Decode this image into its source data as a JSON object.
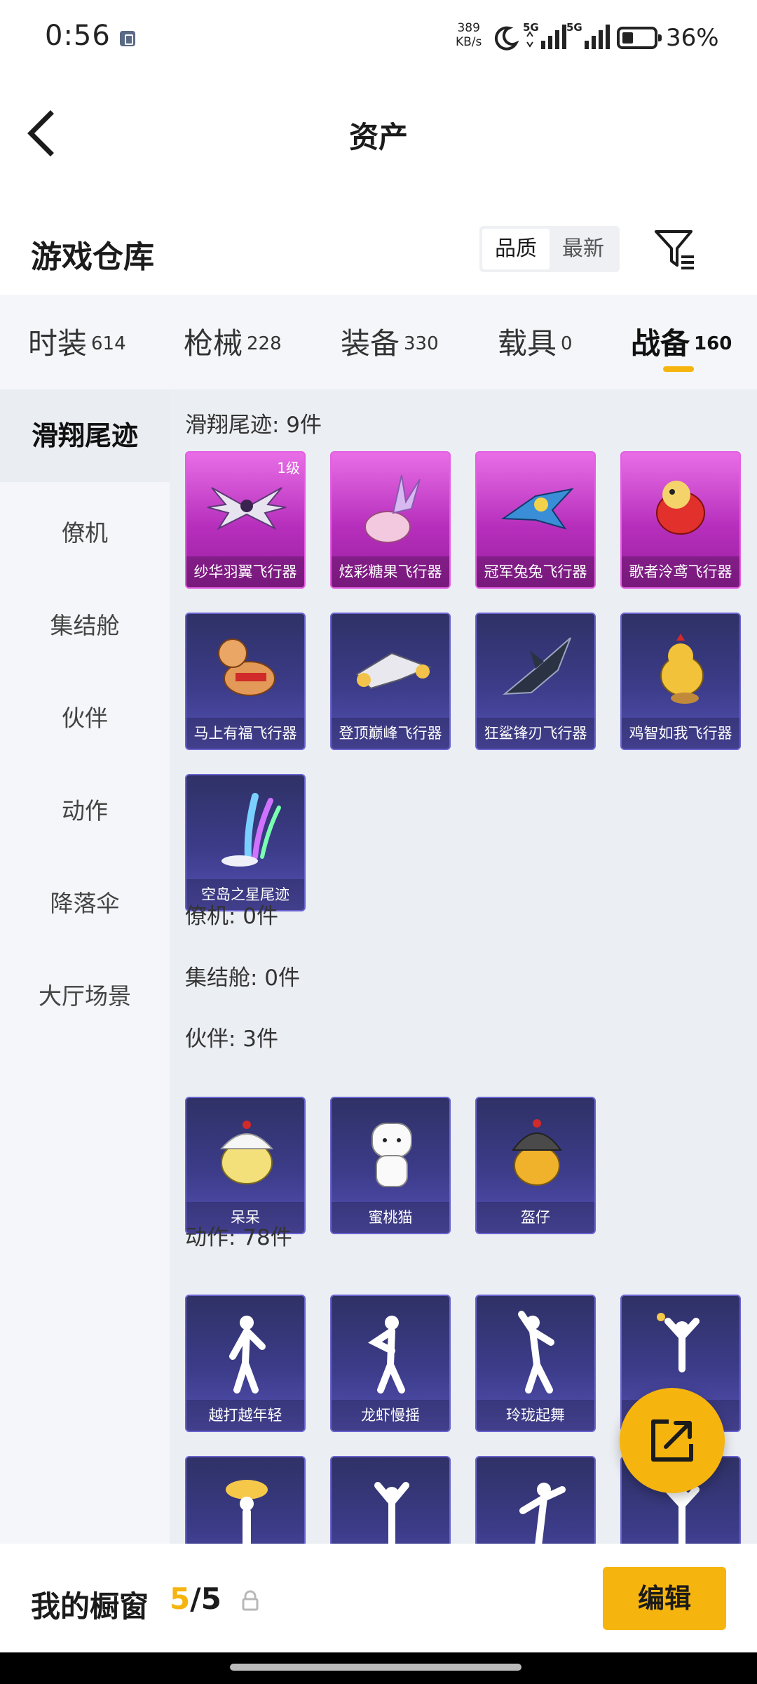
{
  "status_bar": {
    "time": "0:56",
    "net_speed_value": "389",
    "net_speed_unit": "KB/s",
    "signal1_label": "5G",
    "signal2_label": "5G",
    "battery_percent": "36%",
    "battery_level": 0.36
  },
  "header": {
    "title": "资产"
  },
  "warehouse": {
    "title": "游戏仓库",
    "sort_options": [
      "品质",
      "最新"
    ],
    "active_sort": "品质"
  },
  "categories": [
    {
      "name": "时装",
      "count": "614"
    },
    {
      "name": "枪械",
      "count": "228"
    },
    {
      "name": "装备",
      "count": "330"
    },
    {
      "name": "载具",
      "count": "0"
    },
    {
      "name": "战备",
      "count": "160"
    }
  ],
  "sidebar": {
    "items": [
      "滑翔尾迹",
      "僚机",
      "集结舱",
      "伙伴",
      "动作",
      "降落伞",
      "大厅场景"
    ]
  },
  "sections": {
    "glide": {
      "title": "滑翔尾迹: 9件",
      "items": [
        {
          "name": "纱华羽翼飞行器",
          "level": "1级"
        },
        {
          "name": "炫彩糖果飞行器"
        },
        {
          "name": "冠军兔兔飞行器"
        },
        {
          "name": "歌者泠鸢飞行器"
        },
        {
          "name": "马上有福飞行器"
        },
        {
          "name": "登顶巅峰飞行器"
        },
        {
          "name": "狂鲨锋刃飞行器"
        },
        {
          "name": "鸡智如我飞行器"
        },
        {
          "name": "空岛之星尾迹"
        }
      ]
    },
    "wingman": {
      "title": "僚机: 0件"
    },
    "assembly": {
      "title": "集结舱: 0件"
    },
    "partner": {
      "title": "伙伴: 3件",
      "items": [
        {
          "name": "呆呆"
        },
        {
          "name": "蜜桃猫"
        },
        {
          "name": "盔仔"
        }
      ]
    },
    "emote": {
      "title": "动作: 78件",
      "items": [
        {
          "name": "越打越年轻"
        },
        {
          "name": "龙虾慢摇"
        },
        {
          "name": "玲珑起舞"
        },
        {
          "name": ""
        }
      ]
    }
  },
  "showcase": {
    "title": "我的橱窗",
    "current": "5",
    "total": "/5",
    "edit_label": "编辑"
  }
}
